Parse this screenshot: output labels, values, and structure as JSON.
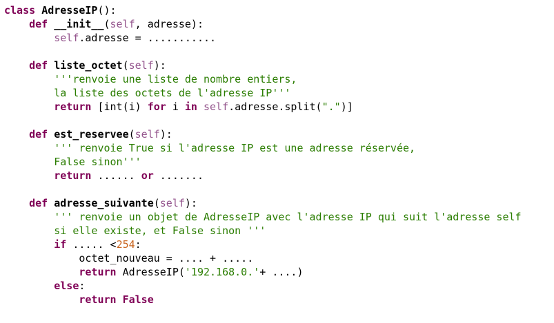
{
  "code": {
    "line1": {
      "kw_class": "class",
      "class_name": "AdresseIP",
      "sig": "():"
    },
    "line2": {
      "indent": "    ",
      "kw_def": "def",
      "fn_name": "__init__",
      "open": "(",
      "self": "self",
      "rest": ", adresse):"
    },
    "line3": {
      "indent": "        ",
      "self": "self",
      "rest": ".adresse = ..........."
    },
    "line4": {
      "indent": "    ",
      "kw_def": "def",
      "fn_name": "liste_octet",
      "open": "(",
      "self": "self",
      "close": "):"
    },
    "line5": {
      "indent": "        ",
      "text": "'''renvoie une liste de nombre entiers,"
    },
    "line6": {
      "indent": "        ",
      "text": "la liste des octets de l'adresse IP'''"
    },
    "line7": {
      "indent": "        ",
      "kw_return": "return",
      "p1": " [int(i) ",
      "kw_for": "for",
      "p2": " i ",
      "kw_in": "in",
      "p3": " ",
      "self": "self",
      "p4": ".adresse.split(",
      "str": "\".\"",
      "p5": ")]"
    },
    "line8": {
      "indent": "    ",
      "kw_def": "def",
      "fn_name": "est_reservee",
      "open": "(",
      "self": "self",
      "close": "):"
    },
    "line9": {
      "indent": "        ",
      "text": "''' renvoie True si l'adresse IP est une adresse réservée,"
    },
    "line10": {
      "indent": "        ",
      "text": "False sinon'''"
    },
    "line11": {
      "indent": "        ",
      "kw_return": "return",
      "p1": " ...... ",
      "kw_or": "or",
      "p2": " ......."
    },
    "line12": {
      "indent": "    ",
      "kw_def": "def",
      "fn_name": "adresse_suivante",
      "open": "(",
      "self": "self",
      "close": "):"
    },
    "line13": {
      "indent": "        ",
      "text": "''' renvoie un objet de AdresseIP avec l'adresse IP qui suit l'adresse self"
    },
    "line14": {
      "indent": "        ",
      "text": "si elle existe, et False sinon '''"
    },
    "line15": {
      "indent": "        ",
      "kw_if": "if",
      "p1": " ..... <",
      "num": "254",
      "p2": ":"
    },
    "line16": {
      "indent": "            ",
      "text": "octet_nouveau = .... + ....."
    },
    "line17": {
      "indent": "            ",
      "kw_return": "return",
      "p1": " AdresseIP(",
      "str": "'192.168.0.'",
      "p2": "+ ....)"
    },
    "line18": {
      "indent": "        ",
      "kw_else": "else",
      "p1": ":"
    },
    "line19": {
      "indent": "            ",
      "kw_return": "return",
      "p1": " ",
      "kw_false": "False"
    }
  },
  "colors": {
    "keyword": "#7f0055",
    "self": "#94558d",
    "string": "#2a7d00",
    "number": "#c8641e",
    "background": "#ffffff"
  }
}
